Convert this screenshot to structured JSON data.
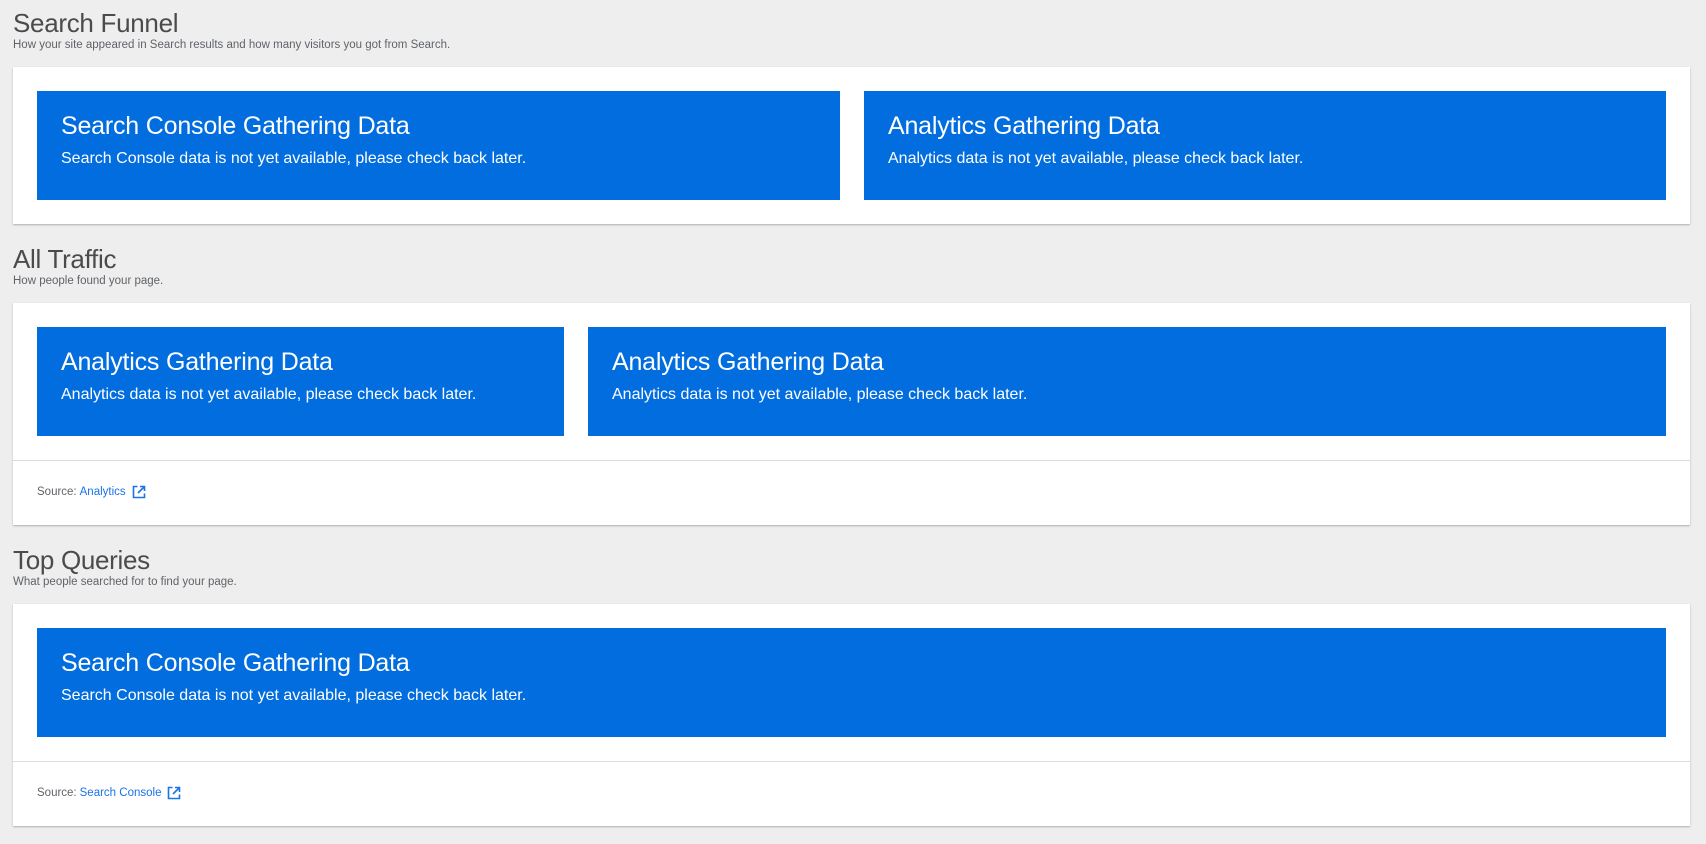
{
  "search_funnel": {
    "title": "Search Funnel",
    "description": "How your site appeared in Search results and how many visitors you got from Search.",
    "notices": [
      {
        "title": "Search Console Gathering Data",
        "text": "Search Console data is not yet available, please check back later."
      },
      {
        "title": "Analytics Gathering Data",
        "text": "Analytics data is not yet available, please check back later."
      }
    ]
  },
  "all_traffic": {
    "title": "All Traffic",
    "description": "How people found your page.",
    "notices": [
      {
        "title": "Analytics Gathering Data",
        "text": "Analytics data is not yet available, please check back later."
      },
      {
        "title": "Analytics Gathering Data",
        "text": "Analytics data is not yet available, please check back later."
      }
    ],
    "source_label": "Source:",
    "source_link": "Analytics"
  },
  "top_queries": {
    "title": "Top Queries",
    "description": "What people searched for to find your page.",
    "notices": [
      {
        "title": "Search Console Gathering Data",
        "text": "Search Console data is not yet available, please check back later."
      }
    ],
    "source_label": "Source:",
    "source_link": "Search Console"
  },
  "colors": {
    "background": "#eeeeee",
    "notice_blue": "#016ddf",
    "link_blue": "#1a73e8"
  },
  "icons": {
    "external_link": "external-link-icon"
  }
}
